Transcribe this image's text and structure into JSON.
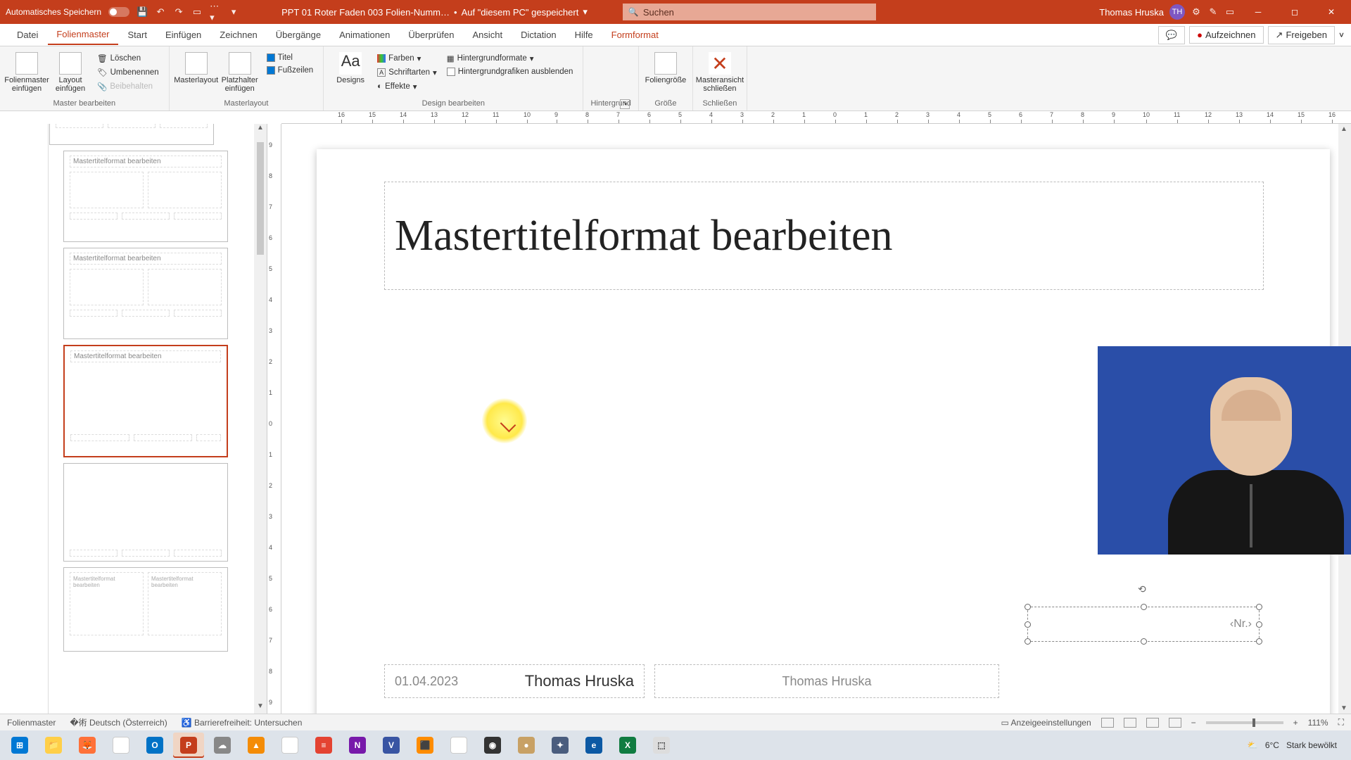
{
  "titlebar": {
    "autosave": "Automatisches Speichern",
    "doc_name": "PPT 01 Roter Faden 003 Folien-Numm…",
    "save_loc_prefix": "Auf \"diesem PC\" gespeichert",
    "search_placeholder": "Suchen",
    "user_name": "Thomas Hruska",
    "user_initials": "TH"
  },
  "tabs": {
    "items": [
      "Datei",
      "Folienmaster",
      "Start",
      "Einfügen",
      "Zeichnen",
      "Übergänge",
      "Animationen",
      "Überprüfen",
      "Ansicht",
      "Dictation",
      "Hilfe",
      "Formformat"
    ],
    "active_index": 1,
    "context_index": 11,
    "record": "Aufzeichnen",
    "share": "Freigeben"
  },
  "ribbon": {
    "g_master": "Master bearbeiten",
    "g_masterlayout": "Masterlayout",
    "g_design": "Design bearbeiten",
    "g_background": "Hintergrund",
    "g_size": "Größe",
    "g_close": "Schließen",
    "btn_insert_master": "Folienmaster einfügen",
    "btn_insert_layout": "Layout einfügen",
    "btn_delete": "Löschen",
    "btn_rename": "Umbenennen",
    "btn_keep": "Beibehalten",
    "btn_masterlayout": "Masterlayout",
    "btn_placeholder": "Platzhalter einfügen",
    "cb_title": "Titel",
    "cb_footer": "Fußzeilen",
    "btn_designs": "Designs",
    "btn_colors": "Farben",
    "btn_fonts": "Schriftarten",
    "btn_effects": "Effekte",
    "btn_bgformat": "Hintergrundformate",
    "cb_hidebg": "Hintergrundgrafiken ausblenden",
    "btn_slidesize": "Foliengröße",
    "btn_closeview": "Masteransicht schließen"
  },
  "ruler": {
    "h_values": [
      16,
      15,
      14,
      13,
      12,
      11,
      10,
      9,
      8,
      7,
      6,
      5,
      4,
      3,
      2,
      1,
      0,
      1,
      2,
      3,
      4,
      5,
      6,
      7,
      8,
      9,
      10,
      11,
      12,
      13,
      14,
      15,
      16
    ],
    "v_values": [
      9,
      8,
      7,
      6,
      5,
      4,
      3,
      2,
      1,
      0,
      1,
      2,
      3,
      4,
      5,
      6,
      7,
      8,
      9
    ]
  },
  "thumbs": {
    "title_text": "Mastertitelformat bearbeiten"
  },
  "slide": {
    "title": "Mastertitelformat bearbeiten",
    "date": "01.04.2023",
    "author": "Thomas Hruska",
    "footer": "Thomas Hruska",
    "number_placeholder": "‹Nr.›"
  },
  "status": {
    "view": "Folienmaster",
    "lang": "Deutsch (Österreich)",
    "access": "Barrierefreiheit: Untersuchen",
    "display": "Anzeigeeinstellungen",
    "zoom": "111%"
  },
  "taskbar": {
    "weather_temp": "6°C",
    "weather_desc": "Stark bewölkt"
  }
}
